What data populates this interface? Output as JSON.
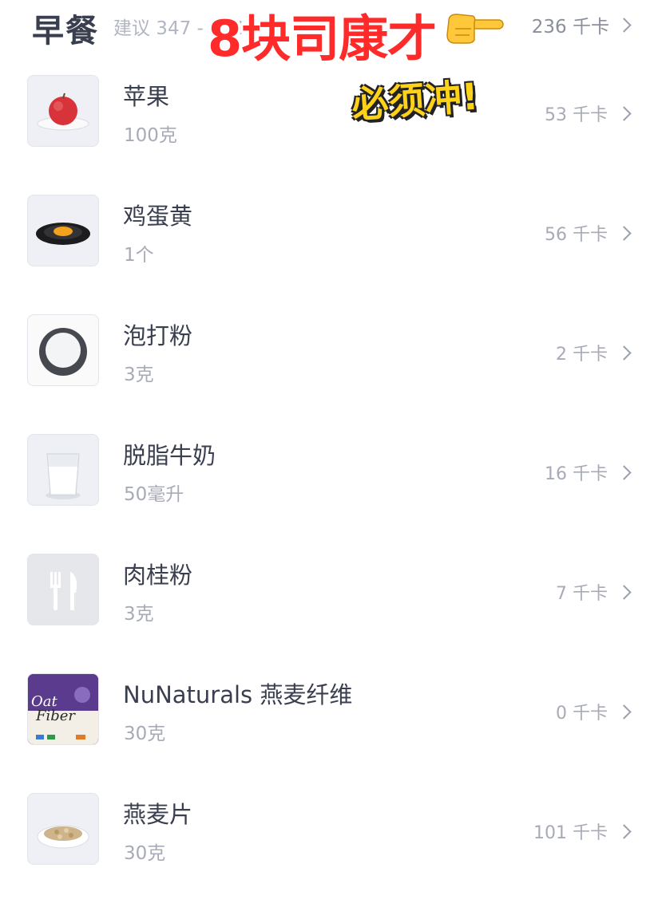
{
  "header": {
    "meal_title": "早餐",
    "suggestion": "建议 347 - 434",
    "total": "236 千卡"
  },
  "overlay": {
    "title": "8块司康才",
    "subtitle": "必须冲!",
    "hand_icon": "pointing-right-hand-emoji"
  },
  "items": [
    {
      "name": "苹果",
      "qty": "100克",
      "kcal": "53 千卡",
      "icon": "apple-photo"
    },
    {
      "name": "鸡蛋黄",
      "qty": "1个",
      "kcal": "56 千卡",
      "icon": "egg-yolk-photo"
    },
    {
      "name": "泡打粉",
      "qty": "3克",
      "kcal": "2 千卡",
      "icon": "baking-powder-photo"
    },
    {
      "name": "脱脂牛奶",
      "qty": "50毫升",
      "kcal": "16 千卡",
      "icon": "milk-glass-photo"
    },
    {
      "name": "肉桂粉",
      "qty": "3克",
      "kcal": "7 千卡",
      "icon": "fork-knife-placeholder"
    },
    {
      "name": "NuNaturals 燕麦纤维",
      "qty": "30克",
      "kcal": "0 千卡",
      "icon": "oat-fiber-package",
      "package_text": [
        "Oat",
        "Fiber"
      ]
    },
    {
      "name": "燕麦片",
      "qty": "30克",
      "kcal": "101 千卡",
      "icon": "oat-flakes-photo"
    }
  ]
}
